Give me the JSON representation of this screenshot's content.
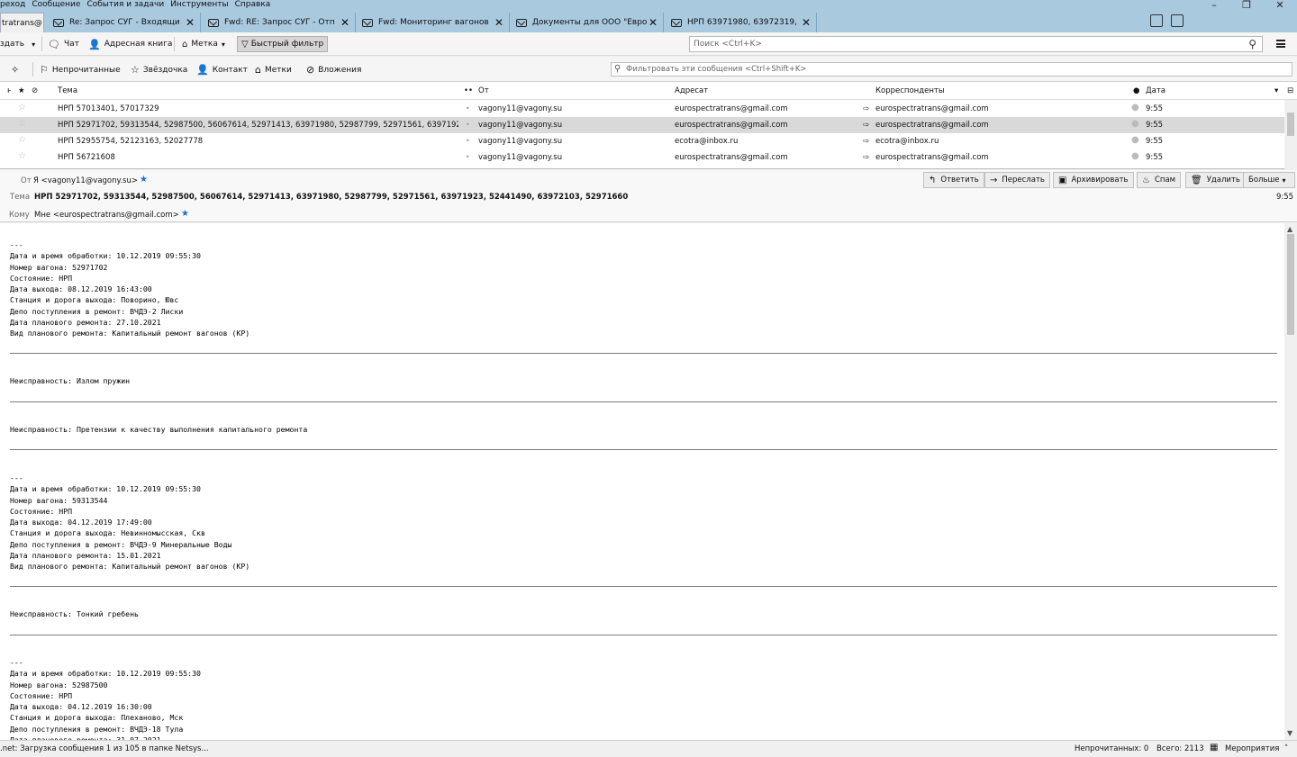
{
  "menubar": {
    "items": [
      "реход",
      "Сообщение",
      "События и задачи",
      "Инструменты",
      "Справка"
    ],
    "window_controls": [
      "–",
      "❐",
      "✕"
    ]
  },
  "tabs": [
    {
      "title": "tratrans@",
      "active": true,
      "icon": "none"
    },
    {
      "title": "Re: Запрос СУГ - Входящи",
      "active": false,
      "icon": "mail-icon"
    },
    {
      "title": "Fwd: RE: Запрос СУГ - Отп",
      "active": false,
      "icon": "mail-icon"
    },
    {
      "title": "Fwd: Мониторинг вагонов",
      "active": false,
      "icon": "mail-icon"
    },
    {
      "title": "Документы для ООО \"Евро",
      "active": false,
      "icon": "mail-icon"
    },
    {
      "title": "НРП 63971980, 63972319, 5",
      "active": false,
      "icon": "mail-icon"
    }
  ],
  "toolbar": {
    "create": "здать",
    "chat": "Чат",
    "address_book": "Адресная книга",
    "tag": "Метка",
    "quick_filter": "Быстрый фильтр",
    "search_placeholder": "Поиск <Ctrl+K>"
  },
  "quickfilter": {
    "unread": "Непрочитанные",
    "starred": "Звёздочка",
    "contact": "Контакт",
    "tags": "Метки",
    "attachments": "Вложения",
    "filter_placeholder": "Фильтровать эти сообщения <Ctrl+Shift+K>"
  },
  "list": {
    "headers": {
      "subject": "Тема",
      "from": "От",
      "recipient": "Адресат",
      "correspondents": "Корреспонденты",
      "date": "Дата"
    },
    "rows": [
      {
        "subject": "НРП 57013401, 57017329",
        "from": "vagony11@vagony.su",
        "recipient": "eurospectratrans@gmail.com",
        "correspondent": "eurospectratrans@gmail.com",
        "date": "9:55",
        "selected": false
      },
      {
        "subject": "НРП 52971702, 59313544, 52987500, 56067614, 52971413, 63971980, 52987799, 52971561, 63971923, 5244...",
        "from": "vagony11@vagony.su",
        "recipient": "eurospectratrans@gmail.com",
        "correspondent": "eurospectratrans@gmail.com",
        "date": "9:55",
        "selected": true
      },
      {
        "subject": "НРП 52955754, 52123163, 52027778",
        "from": "vagony11@vagony.su",
        "recipient": "ecotra@inbox.ru",
        "correspondent": "ecotra@inbox.ru",
        "date": "9:55",
        "selected": false
      },
      {
        "subject": "НРП 56721608",
        "from": "vagony11@vagony.su",
        "recipient": "eurospectratrans@gmail.com",
        "correspondent": "eurospectratrans@gmail.com",
        "date": "9:55",
        "selected": false
      }
    ]
  },
  "message": {
    "from_label": "От",
    "from_value": "Я <vagony11@vagony.su>",
    "subject_label": "Тема",
    "subject_value": "НРП 52971702, 59313544, 52987500, 56067614, 52971413, 63971980, 52987799, 52971561, 63971923, 52441490, 63972103, 52971660",
    "to_label": "Кому",
    "to_value": "Мне <eurospectratrans@gmail.com>",
    "time": "9:55",
    "actions": {
      "reply": "Ответить",
      "forward": "Переслать",
      "archive": "Архивировать",
      "spam": "Спам",
      "delete": "Удалить",
      "more": "Больше"
    },
    "body_blocks": [
      "---\nДата и время обработки: 10.12.2019 09:55:30\nНомер вагона: 52971702\nСостояние: НРП\nДата выхода: 08.12.2019 16:43:00\nСтанция и дорога выхода: Поворино, Ювс\nДепо поступления в ремонт: ВЧДЭ-2 Лиски\nДата планового ремонта: 27.10.2021\nВид планового ремонта: Капитальный ремонт вагонов (КР)",
      "Неисправность: Излом пружин",
      "Неисправность: Претензии к качеству выполнения капитального ремонта",
      "---\nДата и время обработки: 10.12.2019 09:55:30\nНомер вагона: 59313544\nСостояние: НРП\nДата выхода: 04.12.2019 17:49:00\nСтанция и дорога выхода: Невинномысская, Скв\nДепо поступления в ремонт: ВЧДЭ-9 Минеральные Воды\nДата планового ремонта: 15.01.2021\nВид планового ремонта: Капитальный ремонт вагонов (КР)",
      "Неисправность: Тонкий гребень",
      "---\nДата и время обработки: 10.12.2019 09:55:30\nНомер вагона: 52987500\nСостояние: НРП\nДата выхода: 04.12.2019 16:30:00\nСтанция и дорога выхода: Плеханово, Мск\nДепо поступления в ремонт: ВЧДЭ-18 Тула\nДата планового ремонта: 31.07.2021"
    ]
  },
  "status": {
    "left": ".net: Загрузка сообщения 1 из 105 в папке Netsys...",
    "unread": "Непрочитанных: 0",
    "total": "Всего: 2113",
    "events": "Мероприятия"
  }
}
